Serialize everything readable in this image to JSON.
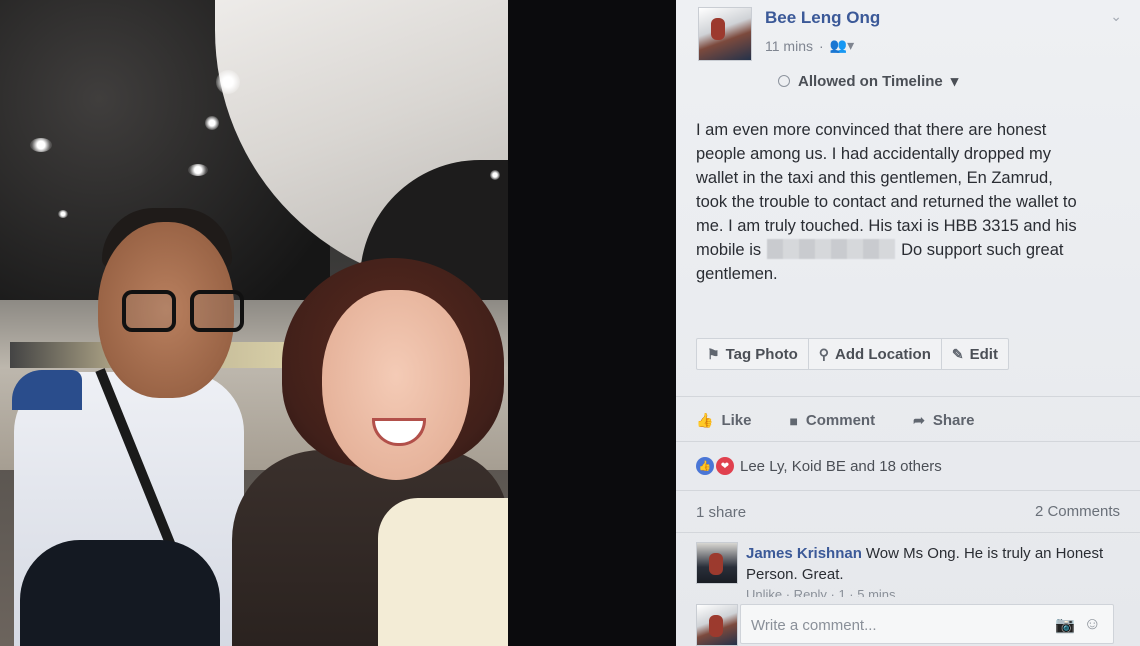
{
  "post": {
    "author": "Bee Leng Ong",
    "time": "11 mins",
    "audience_icon": "friends-icon",
    "timeline_label": "Allowed on Timeline",
    "text_lines": [
      "I am even more convinced that there are honest",
      "people among us. I had accidentally dropped my",
      "wallet in the taxi and this gentlemen, En Zamrud,",
      "took the trouble to contact and returned the wallet to",
      "me. I am truly touched. His taxi is HBB 3315 and his",
      "mobile is",
      "Do support such great",
      "gentlemen."
    ]
  },
  "photo_actions": [
    {
      "label": "Tag Photo",
      "icon": "tag-icon"
    },
    {
      "label": "Add Location",
      "icon": "location-pin-icon"
    },
    {
      "label": "Edit",
      "icon": "pencil-icon"
    }
  ],
  "reactions_bar": {
    "like": "Like",
    "comment": "Comment",
    "share": "Share"
  },
  "engagement": {
    "likers": "Lee Ly, Koid BE and 18 others",
    "shares": "1 share",
    "comments": "2 Comments"
  },
  "comments": [
    {
      "author": "James Krishnan",
      "text": "Wow Ms Ong. He is truly an Honest Person. Great.",
      "meta": "Unlike · Reply · 1 · 5 mins"
    }
  ],
  "composer": {
    "placeholder": "Write a comment..."
  },
  "colors": {
    "name_blue": "#3b5998",
    "like_blue": "#4a76d6",
    "love_red": "#e0404e"
  }
}
